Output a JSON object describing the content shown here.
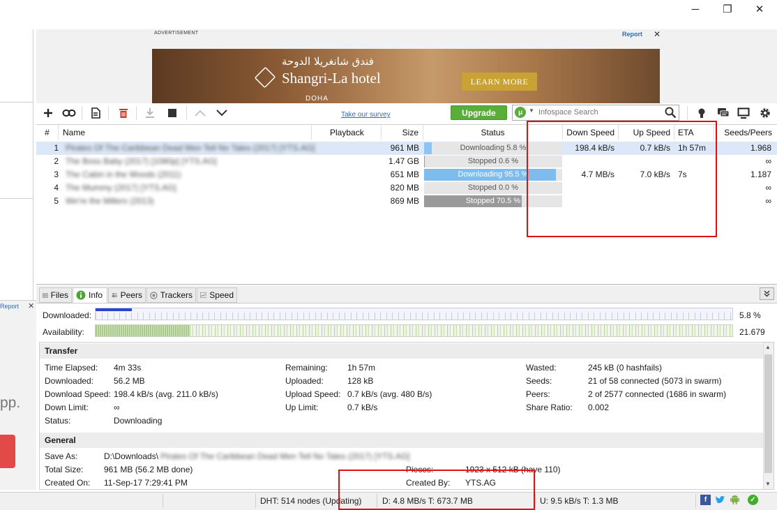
{
  "window": {
    "minimize": "─",
    "restore": "❐",
    "close": "✕"
  },
  "left_ad": {
    "report": "Report",
    "close": "✕",
    "text": "pp."
  },
  "advertisement": {
    "label": "ADVERTISEMENT",
    "report": "Report",
    "close": "✕",
    "arabic": "فندق شانغريلا الدوحة",
    "hotel": "Shangri-La hotel",
    "city": "DOHA",
    "cta": "LEARN MORE"
  },
  "toolbar": {
    "survey": "Take our survey",
    "upgrade": "Upgrade",
    "search_logo": "μ",
    "search_placeholder": "Infospace Search"
  },
  "list": {
    "columns": {
      "num": "#",
      "name": "Name",
      "playback": "Playback",
      "size": "Size",
      "status": "Status",
      "down_speed": "Down Speed",
      "up_speed": "Up Speed",
      "eta": "ETA",
      "seeds_peers": "Seeds/Peers"
    },
    "rows": [
      {
        "num": "1",
        "name": "Pirates Of The Caribbean Dead Men Tell No Tales (2017) [YTS.AG]",
        "size": "961 MB",
        "status": "Downloading 5.8 %",
        "progress": 0.058,
        "bar_color": "#8fc3f0",
        "down": "198.4 kB/s",
        "up": "0.7 kB/s",
        "eta": "1h 57m",
        "seeds": "1.968"
      },
      {
        "num": "2",
        "name": "The Boss Baby (2017) [1080p] [YTS.AG]",
        "size": "1.47 GB",
        "status": "Stopped 0.6 %",
        "progress": 0.006,
        "bar_color": "#9a9a9a",
        "down": "",
        "up": "",
        "eta": "",
        "seeds": "∞"
      },
      {
        "num": "3",
        "name": "The Cabin in the Woods (2011)",
        "size": "651 MB",
        "status": "Downloading 95.5 %",
        "progress": 0.955,
        "bar_color": "#7fbcee",
        "down": "4.7 MB/s",
        "up": "7.0 kB/s",
        "eta": "7s",
        "seeds": "1.187"
      },
      {
        "num": "4",
        "name": "The Mummy (2017) [YTS.AG]",
        "size": "820 MB",
        "status": "Stopped 0.0 %",
        "progress": 0.0,
        "bar_color": "#9a9a9a",
        "down": "",
        "up": "",
        "eta": "",
        "seeds": "∞"
      },
      {
        "num": "5",
        "name": "We're the Millers (2013)",
        "size": "869 MB",
        "status": "Stopped 70.5 %",
        "progress": 0.705,
        "bar_color": "#9a9a9a",
        "down": "",
        "up": "",
        "eta": "",
        "seeds": "∞"
      }
    ]
  },
  "tabs": [
    "Files",
    "Info",
    "Peers",
    "Trackers",
    "Speed"
  ],
  "pieces": {
    "downloaded_label": "Downloaded:",
    "downloaded_value": "5.8 %",
    "availability_label": "Availability:",
    "availability_value": "21.679"
  },
  "transfer": {
    "title": "Transfer",
    "time_elapsed_label": "Time Elapsed:",
    "time_elapsed": "4m 33s",
    "downloaded_label": "Downloaded:",
    "downloaded": "56.2 MB",
    "download_speed_label": "Download Speed:",
    "download_speed": "198.4 kB/s (avg. 211.0 kB/s)",
    "down_limit_label": "Down Limit:",
    "down_limit": "∞",
    "status_label": "Status:",
    "status": "Downloading",
    "remaining_label": "Remaining:",
    "remaining": "1h 57m",
    "uploaded_label": "Uploaded:",
    "uploaded": "128 kB",
    "upload_speed_label": "Upload Speed:",
    "upload_speed": "0.7 kB/s (avg. 480 B/s)",
    "up_limit_label": "Up Limit:",
    "up_limit": "0.7 kB/s",
    "wasted_label": "Wasted:",
    "wasted": "245 kB (0 hashfails)",
    "seeds_label": "Seeds:",
    "seeds": "21 of 58 connected (5073 in swarm)",
    "peers_label": "Peers:",
    "peers": "2 of 2577 connected (1686 in swarm)",
    "share_ratio_label": "Share Ratio:",
    "share_ratio": "0.002"
  },
  "general": {
    "title": "General",
    "save_as_label": "Save As:",
    "save_as_prefix": "D:\\Downloads\\",
    "save_as_blurred": "Pirates Of The Caribbean Dead Men Tell No Tales (2017) [YTS.AG]",
    "total_size_label": "Total Size:",
    "total_size": "961 MB (56.2 MB done)",
    "created_on_label": "Created On:",
    "created_on": "11-Sep-17 7:29:41 PM",
    "pieces_label": "Pieces:",
    "pieces": "1923 x 512 kB (have 110)",
    "created_by_label": "Created By:",
    "created_by": "YTS.AG"
  },
  "status_bar": {
    "dht": "DHT: 514 nodes (Updating)",
    "down": "D: 4.8 MB/s T: 673.7 MB",
    "up": "U: 9.5 kB/s T: 1.3 MB"
  },
  "colors": {
    "accent_green": "#5aad3a",
    "highlight_red": "#e01010",
    "selected_row": "#dce8f7",
    "link_blue": "#2a6ebb"
  }
}
